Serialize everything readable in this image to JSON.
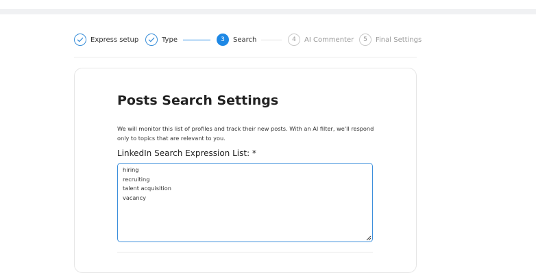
{
  "steps": [
    {
      "label": "Express setup",
      "state": "done",
      "marker": "check"
    },
    {
      "label": "Type",
      "state": "done",
      "marker": "check"
    },
    {
      "label": "Search",
      "state": "active",
      "marker": "3"
    },
    {
      "label": "AI Commenter",
      "state": "pending",
      "marker": "4"
    },
    {
      "label": "Final Settings",
      "state": "pending",
      "marker": "5"
    }
  ],
  "form": {
    "title": "Posts Search Settings",
    "description": "We will monitor this list of profiles and track their new posts. With an AI filter, we'll respond only to topics that are relevant to you.",
    "field_label": "LinkedIn Search Expression List: *",
    "expressions": [
      "hiring",
      "recruiting",
      "talent acquisition",
      "vacancy"
    ]
  },
  "colors": {
    "accent": "#1e88e5",
    "inactive": "#c9c9c9"
  }
}
